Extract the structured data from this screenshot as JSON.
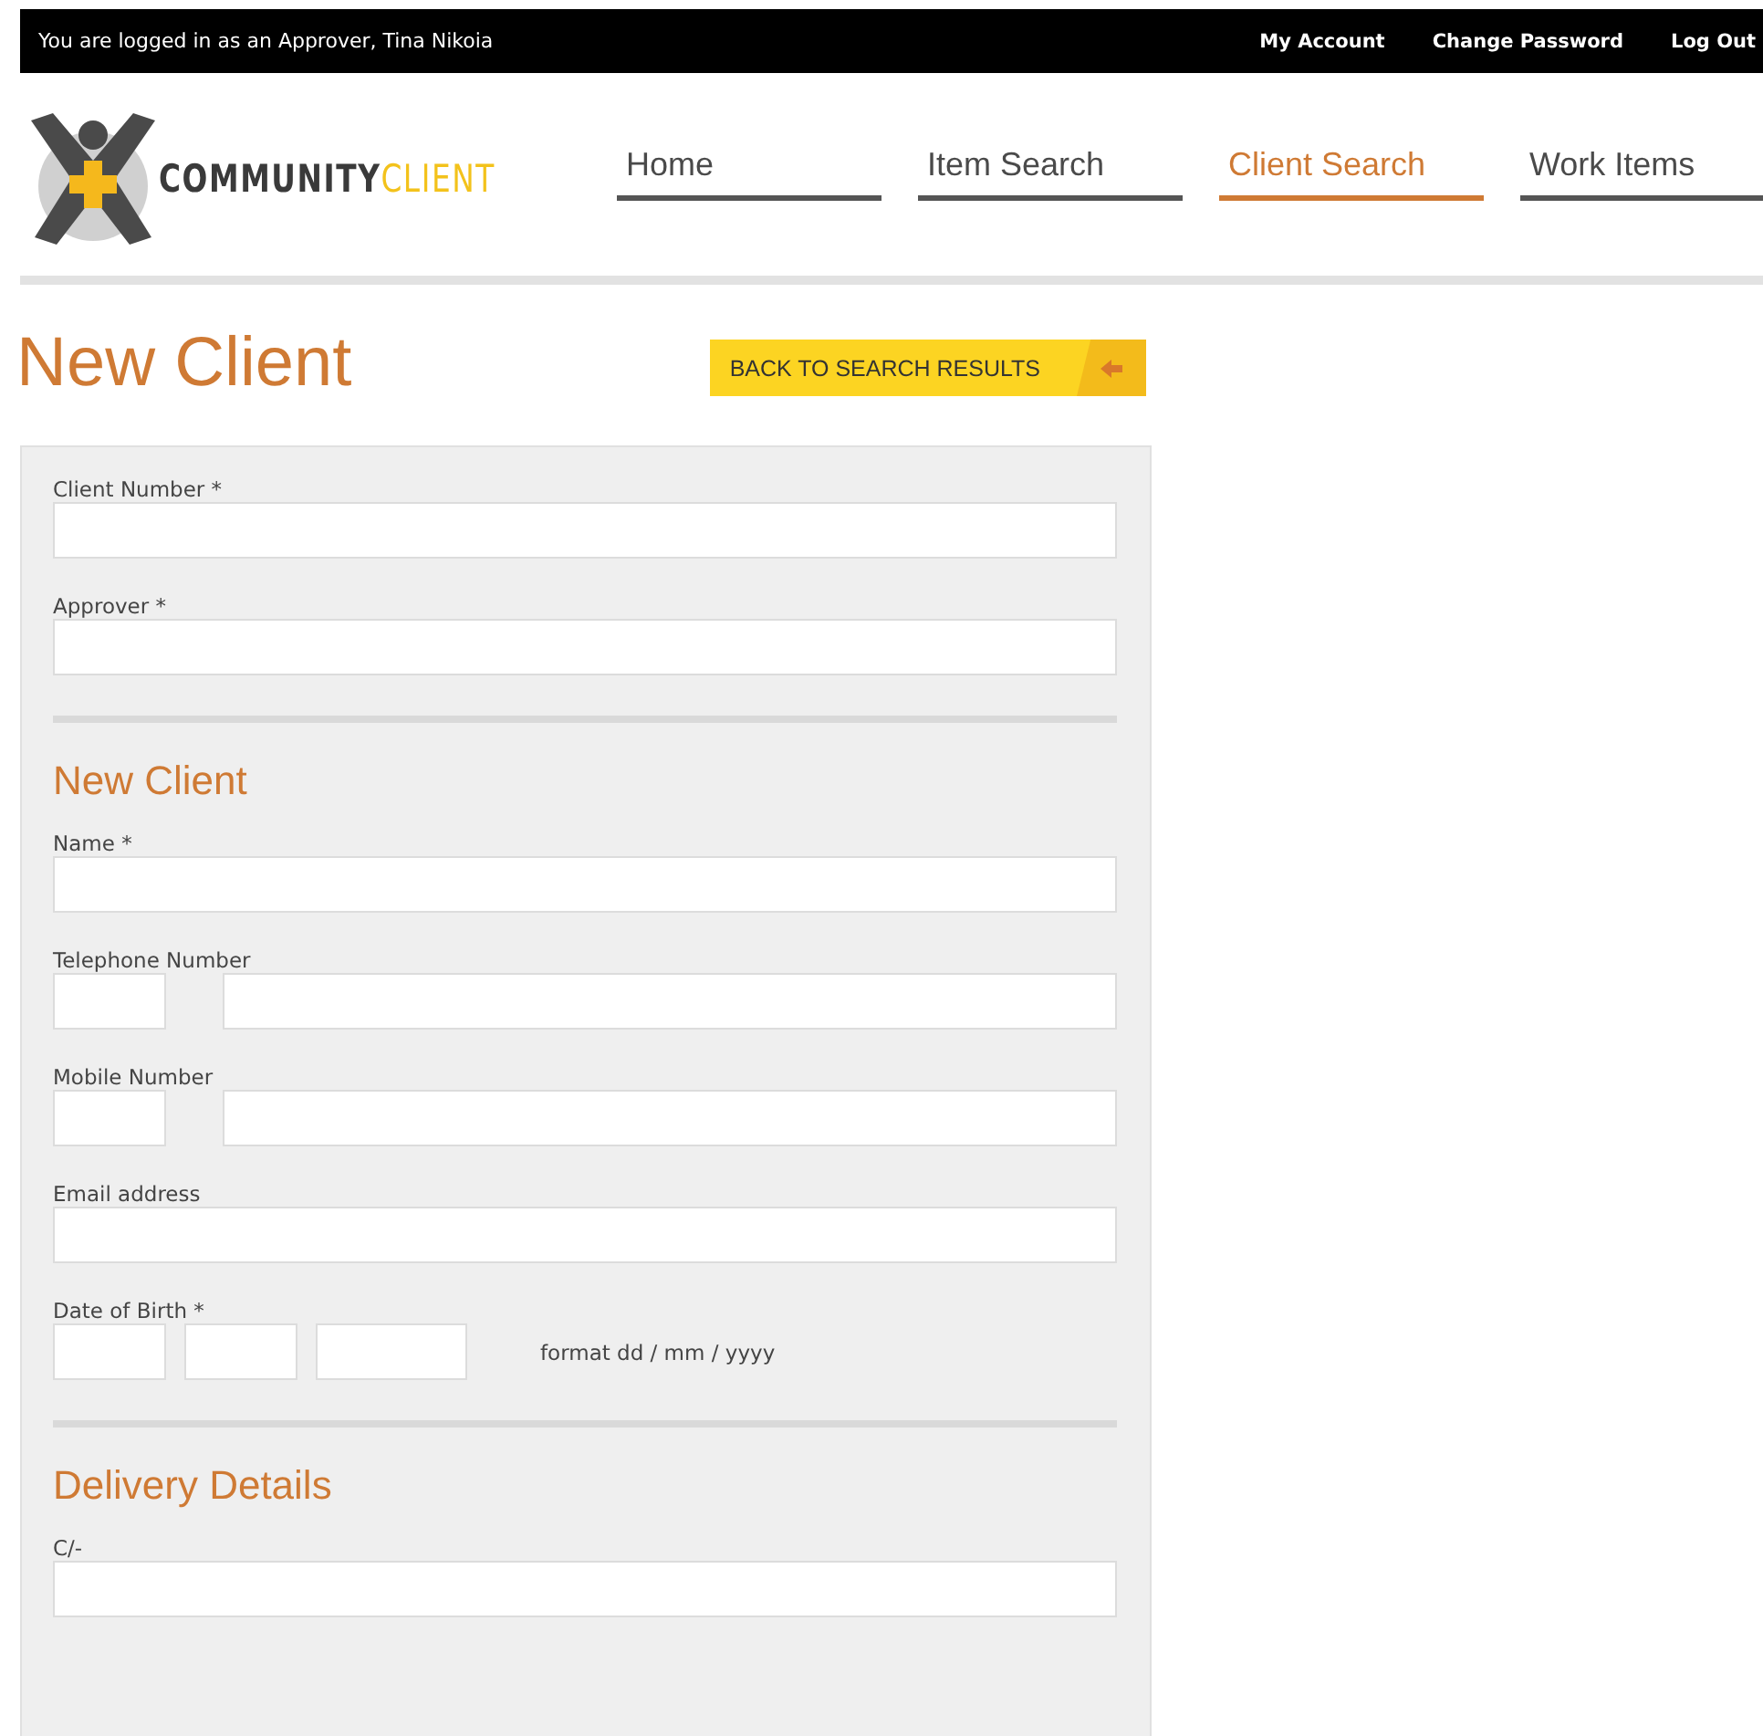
{
  "top_bar": {
    "status": "You are logged in as an Approver, Tina Nikoia",
    "links": [
      "My Account",
      "Change Password",
      "Log Out"
    ]
  },
  "logo": {
    "primary": "COMMUNITY",
    "accent": "CLIENT"
  },
  "nav": [
    {
      "label": "Home",
      "selected": false
    },
    {
      "label": "Item Search",
      "selected": false
    },
    {
      "label": "Client Search",
      "selected": true
    },
    {
      "label": "Work Items",
      "selected": false
    }
  ],
  "page_title": "New Client",
  "back_button": {
    "label": "BACK TO SEARCH RESULTS"
  },
  "form": {
    "sections": [
      {
        "fields": [
          {
            "kind": "text",
            "label": "Client Number *"
          },
          {
            "kind": "text",
            "label": "Approver *"
          }
        ]
      },
      {
        "heading": "New Client",
        "fields": [
          {
            "kind": "text",
            "label": "Name *"
          },
          {
            "kind": "phone",
            "label": "Telephone Number"
          },
          {
            "kind": "phone",
            "label": "Mobile Number"
          },
          {
            "kind": "text",
            "label": "Email address"
          },
          {
            "kind": "date",
            "label": "Date of Birth *",
            "hint": "format dd / mm / yyyy"
          }
        ]
      },
      {
        "heading": "Delivery Details",
        "fields": [
          {
            "kind": "text",
            "label": "C/-"
          }
        ]
      }
    ]
  }
}
